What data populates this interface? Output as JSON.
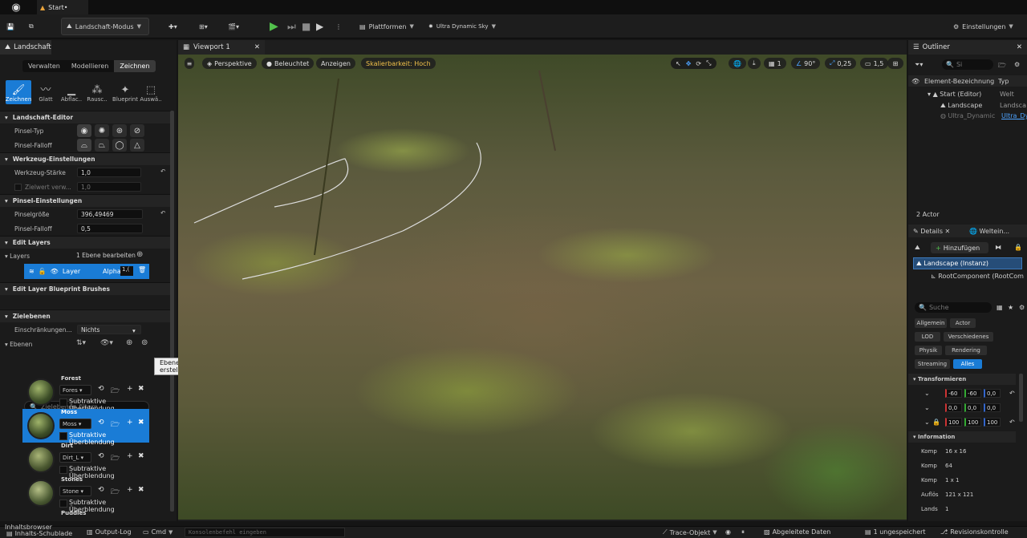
{
  "window": {
    "tab_title": "Start•"
  },
  "toolbar": {
    "mode": "Landschaft-Modus",
    "platforms": "Plattformen",
    "sky": "Ultra Dynamic Sky",
    "settings": "Einstellungen"
  },
  "left_panel": {
    "tab": "Landschaft",
    "segments": [
      "Verwalten",
      "Modellieren",
      "Zeichnen"
    ],
    "tools": [
      "Zeichnen",
      "Glatt",
      "Abflac..",
      "Rausc..",
      "Blueprint",
      "Auswä.."
    ],
    "sections": {
      "editor": "Landschaft-Editor",
      "tool_settings": "Werkzeug-Einstellungen",
      "brush_settings": "Pinsel-Einstellungen",
      "edit_layers": "Edit Layers",
      "edit_layer_bp": "Edit Layer Blueprint Brushes",
      "target_layers": "Zielebenen"
    },
    "brush_type_label": "Pinsel-Typ",
    "brush_falloff_label": "Pinsel-Falloff",
    "tool_strength_label": "Werkzeug-Stärke",
    "tool_strength_value": "1,0",
    "target_value_label": "Zielwert verw...",
    "target_value_value": "1,0",
    "brush_size_label": "Pinselgröße",
    "brush_size_value": "396,49469",
    "brush_falloff2_label": "Pinsel-Falloff",
    "brush_falloff2_value": "0,5",
    "layers_label": "Layers",
    "layers_edit": "1 Ebene bearbeiten",
    "layer_name": "Layer",
    "layer_alpha_label": "Alpha",
    "layer_alpha_value": "1,(",
    "restrictions_label": "Einschränkungen...",
    "restrictions_value": "Nichts",
    "levels_label": "Ebenen",
    "filter_placeholder": "Zielebenen filtern",
    "layers": [
      {
        "name": "Forest",
        "dropdown": "Fores",
        "sub": "Subtraktive Überblendung"
      },
      {
        "name": "Moss",
        "dropdown": "Moss",
        "sub": "Subtraktive Überblendung"
      },
      {
        "name": "Dirt",
        "dropdown": "Dirt_L",
        "sub": "Subtraktive Überblendung"
      },
      {
        "name": "Stones",
        "dropdown": "Stone",
        "sub": "Subtraktive Überblendung"
      },
      {
        "name": "Puddles"
      }
    ]
  },
  "tooltip": "Ebenen aus zugewiesenen Materialien erstellen",
  "viewport": {
    "tab": "Viewport 1",
    "perspective": "Perspektive",
    "lit": "Beleuchtet",
    "show": "Anzeigen",
    "scalability": "Skalierbarkeit: Hoch",
    "grid": "1",
    "angle": "90°",
    "scale": "0,25",
    "speed": "1,5"
  },
  "outliner": {
    "tab": "Outliner",
    "search_placeholder": "Si",
    "col_label": "Element-Bezeichnung",
    "col_type": "Typ",
    "rows": [
      {
        "name": "Start (Editor)",
        "type": "Welt"
      },
      {
        "name": "Landscape",
        "type": "Landsca"
      },
      {
        "name": "Ultra_Dynamic",
        "type": "Ultra_Dy"
      }
    ],
    "count": "2 Actor"
  },
  "details": {
    "tab": "Details",
    "tab2": "Weltein...",
    "add": "Hinzufügen",
    "instance": "Landscape (Instanz)",
    "root": "RootComponent (RootCom",
    "search_placeholder": "Suche",
    "chips": [
      "Allgemein",
      "Actor",
      "LOD",
      "Verschiedenes",
      "Physik",
      "Rendering",
      "Streaming",
      "Alles"
    ],
    "transform": "Transformieren",
    "loc": [
      "-60",
      "-60",
      "0,0"
    ],
    "rot": [
      "0,0",
      "0,0",
      "0,0"
    ],
    "scale": [
      "100",
      "100",
      "100"
    ],
    "info": "Information",
    "info_rows": [
      {
        "k": "Komp",
        "v": "16 x 16"
      },
      {
        "k": "Komp",
        "v": "64"
      },
      {
        "k": "Komp",
        "v": "1 x 1"
      },
      {
        "k": "Auflös",
        "v": "121 x 121"
      },
      {
        "k": "Lands",
        "v": "1"
      }
    ]
  },
  "bottom": {
    "content_drawer": "Inhaltsbrowser",
    "content_drawer2": "Inhalts-Schublade",
    "output_log": "Output-Log",
    "cmd": "Cmd",
    "console_placeholder": "Konsolenbefehl eingeben",
    "trace": "Trace-Objekt",
    "derived": "Abgeleitete Daten",
    "unsaved": "1 ungespeichert",
    "revision": "Revisionskontrolle"
  }
}
